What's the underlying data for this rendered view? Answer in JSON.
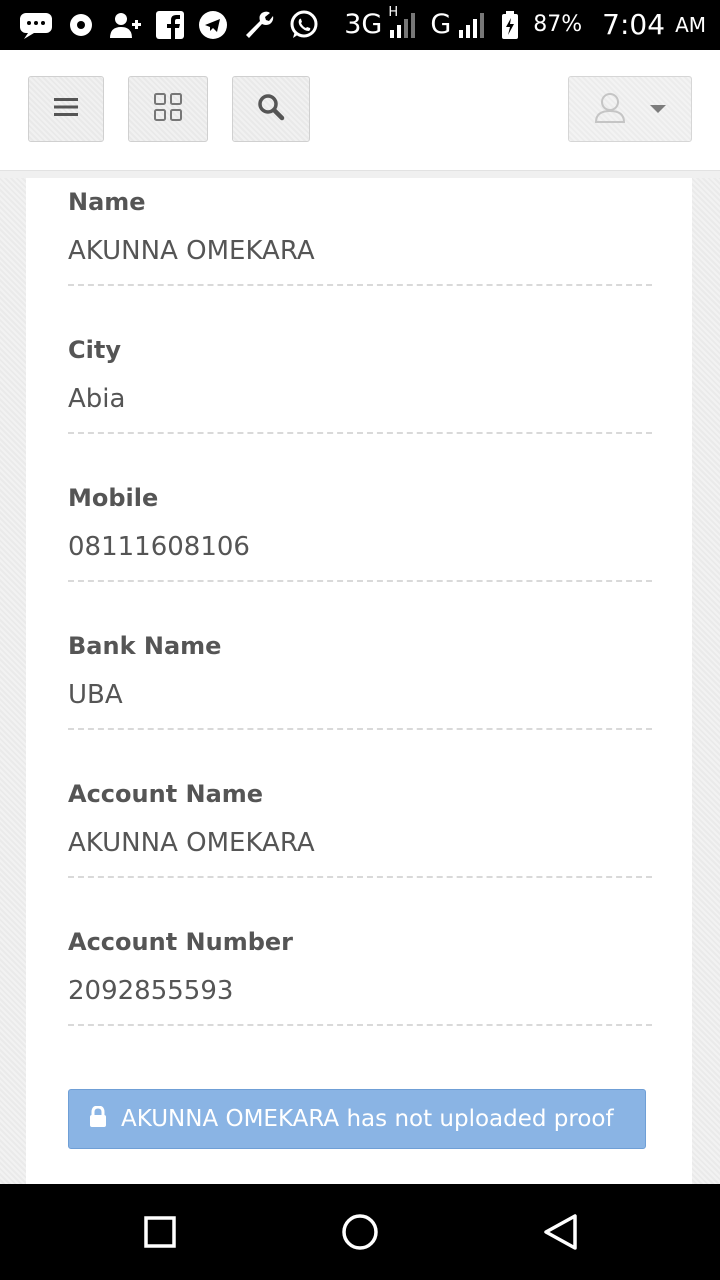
{
  "status_bar": {
    "network_3g": "3G",
    "network_h": "H",
    "network_g": "G",
    "battery": "87%",
    "time": "7:04",
    "ampm": "AM",
    "icons": [
      "messages-icon",
      "record-icon",
      "add-contact-icon",
      "facebook-icon",
      "telegram-icon",
      "wrench-icon",
      "whatsapp-icon",
      "signal-icon",
      "signal-icon",
      "battery-charging-icon"
    ]
  },
  "toolbar": {
    "menu_icon": "hamburger-menu-icon",
    "grid_icon": "grid-icon",
    "search_icon": "search-icon",
    "user_icon": "user-avatar-icon",
    "dropdown_icon": "caret-down-icon"
  },
  "details": {
    "fields": [
      {
        "label": "Name",
        "value": "AKUNNA OMEKARA"
      },
      {
        "label": "City",
        "value": "Abia"
      },
      {
        "label": "Mobile",
        "value": "08111608106"
      },
      {
        "label": "Bank Name",
        "value": "UBA"
      },
      {
        "label": "Account Name",
        "value": "AKUNNA OMEKARA"
      },
      {
        "label": "Account Number",
        "value": "2092855593"
      }
    ]
  },
  "proof_alert": {
    "icon": "lock-icon",
    "text": "AKUNNA OMEKARA has not uploaded proof",
    "color": "#8ab4e4"
  },
  "nav_bar": {
    "icons": [
      "recents-square-icon",
      "home-circle-icon",
      "back-triangle-icon"
    ]
  }
}
